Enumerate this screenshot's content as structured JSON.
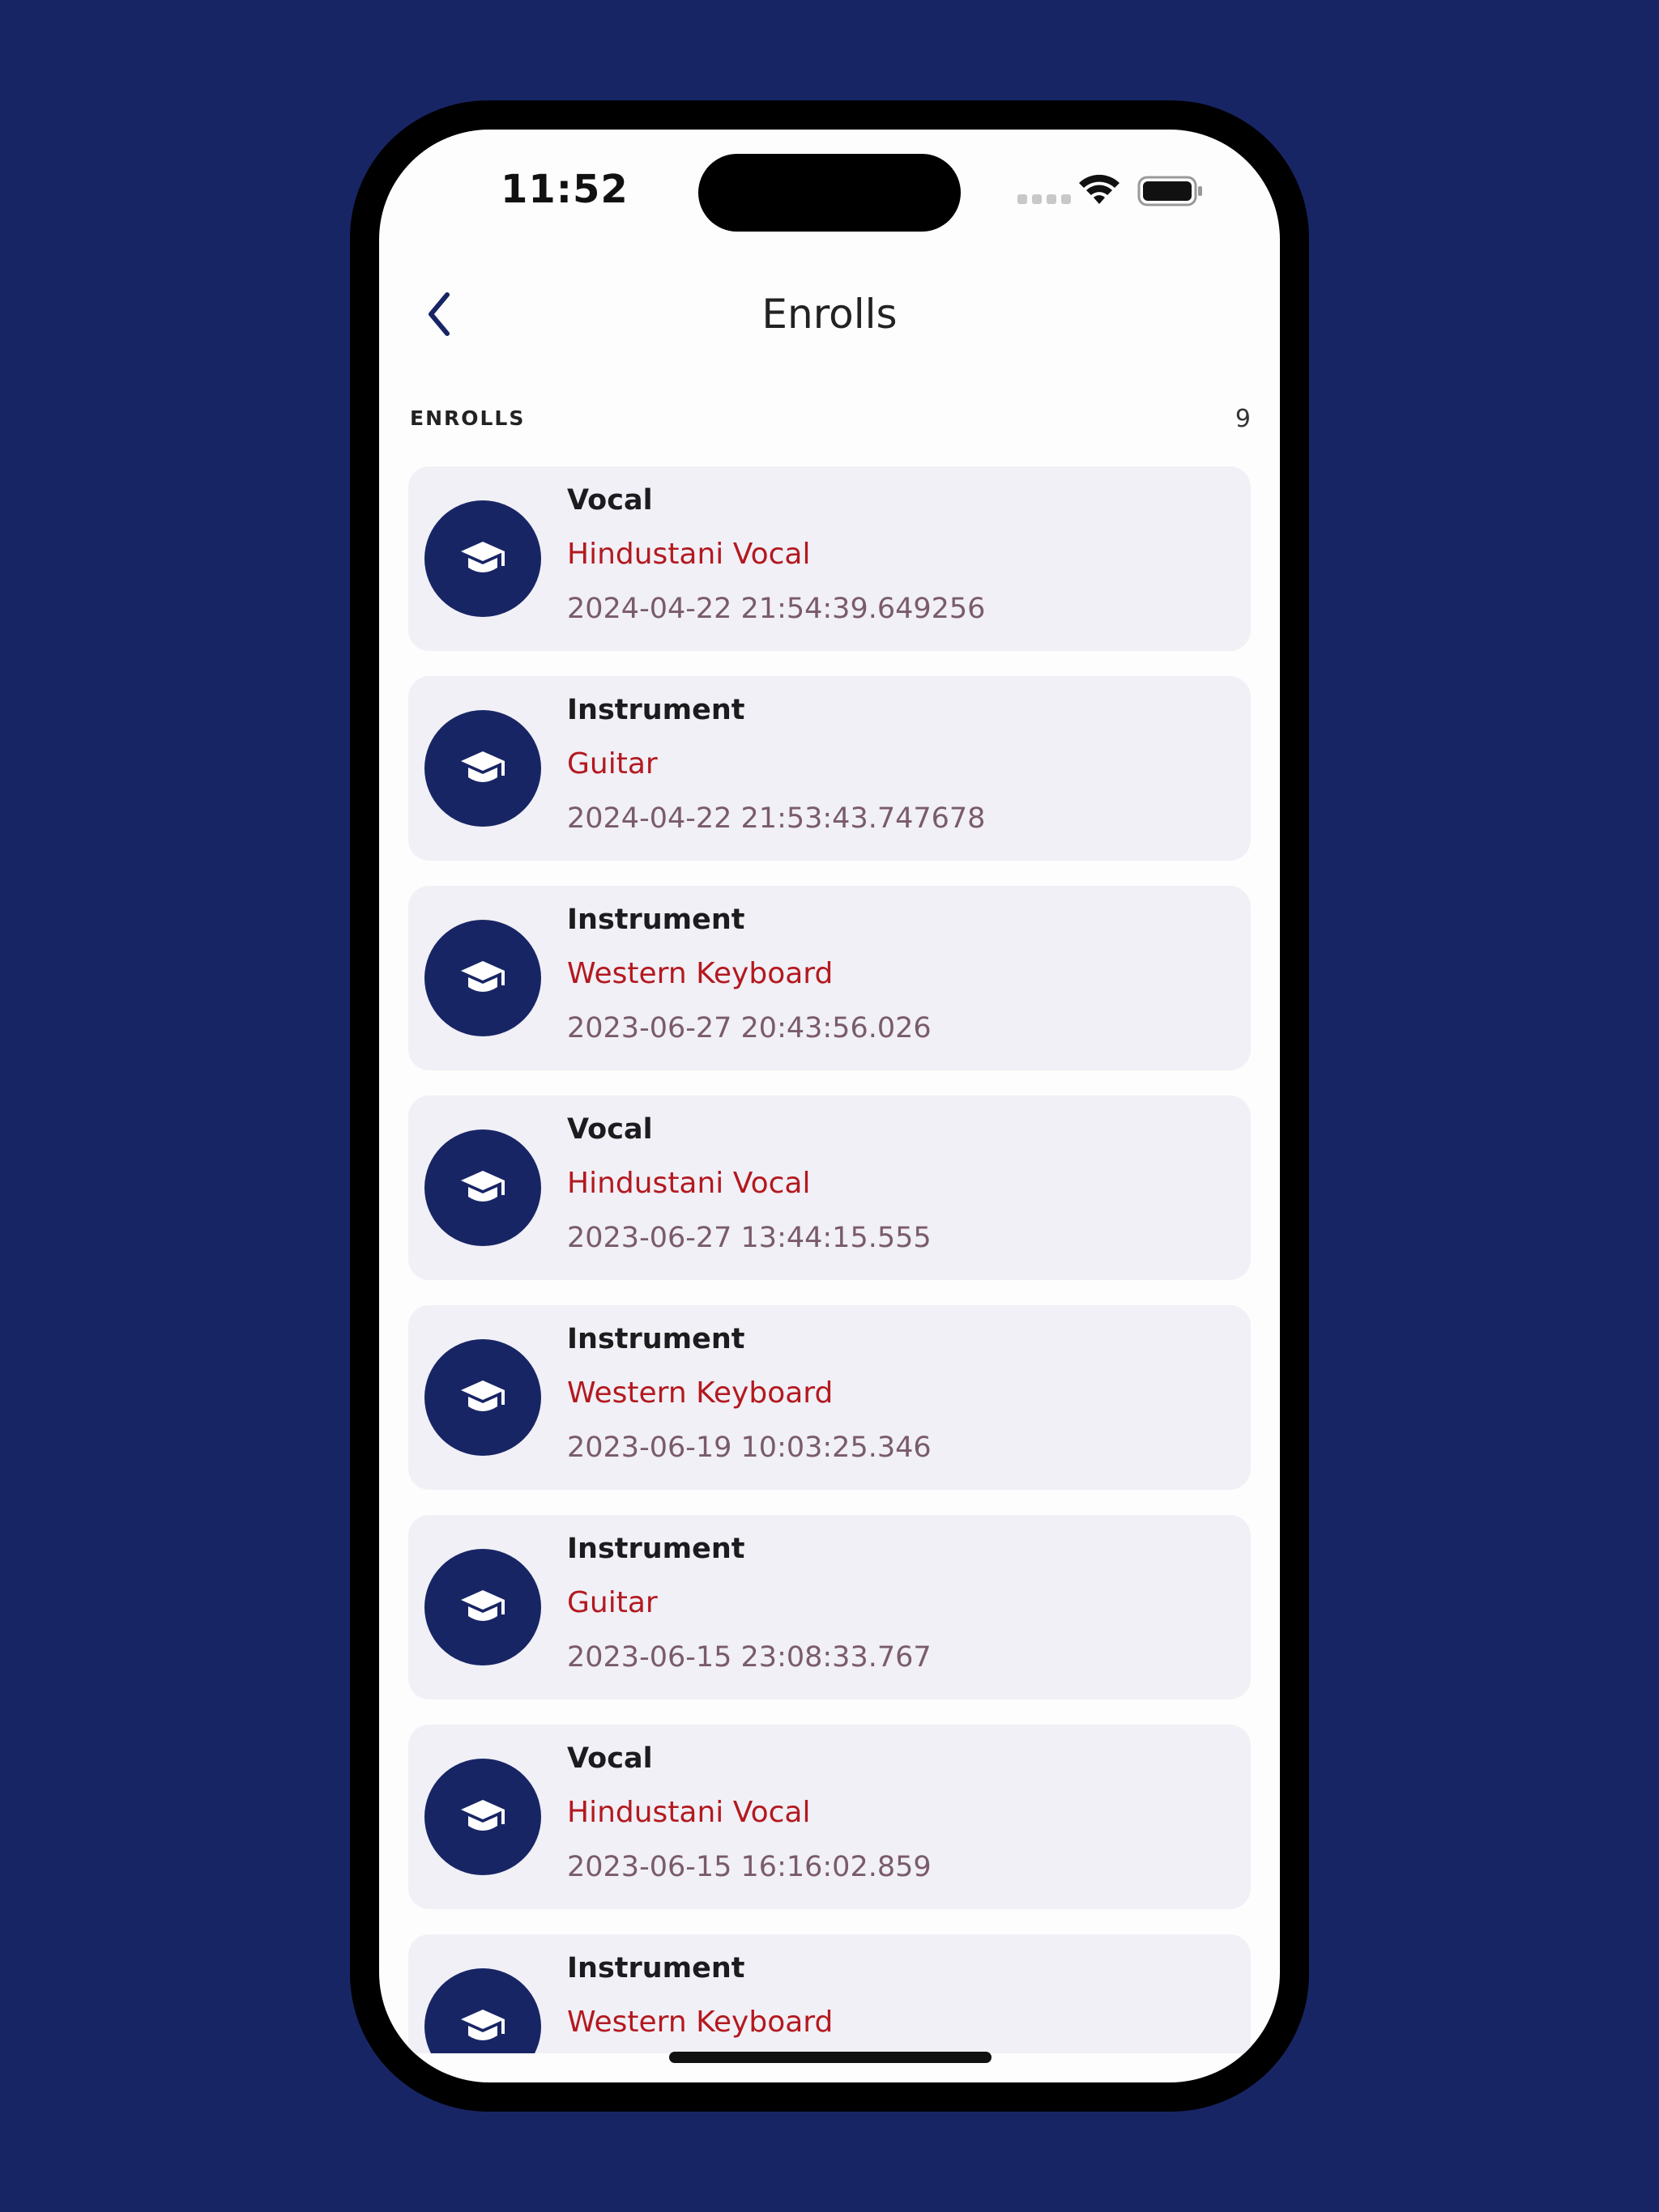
{
  "status_bar": {
    "time": "11:52"
  },
  "nav": {
    "title": "Enrolls",
    "back_icon": "chevron-left-icon"
  },
  "section": {
    "label": "ENROLLS",
    "count": "9"
  },
  "enrollments": [
    {
      "type": "Vocal",
      "course": "Hindustani Vocal",
      "date": "2024-04-22 21:54:39.649256"
    },
    {
      "type": "Instrument",
      "course": "Guitar",
      "date": "2024-04-22 21:53:43.747678"
    },
    {
      "type": "Instrument",
      "course": "Western Keyboard",
      "date": "2023-06-27 20:43:56.026"
    },
    {
      "type": "Vocal",
      "course": "Hindustani Vocal",
      "date": "2023-06-27 13:44:15.555"
    },
    {
      "type": "Instrument",
      "course": "Western Keyboard",
      "date": "2023-06-19 10:03:25.346"
    },
    {
      "type": "Instrument",
      "course": "Guitar",
      "date": "2023-06-15 23:08:33.767"
    },
    {
      "type": "Vocal",
      "course": "Hindustani Vocal",
      "date": "2023-06-15 16:16:02.859"
    },
    {
      "type": "Instrument",
      "course": "Western Keyboard",
      "date": ""
    }
  ],
  "colors": {
    "background": "#182565",
    "accent": "#182565",
    "course_text": "#b3191f",
    "date_text": "#7a5b6b",
    "card_background": "#f0f0f6"
  }
}
